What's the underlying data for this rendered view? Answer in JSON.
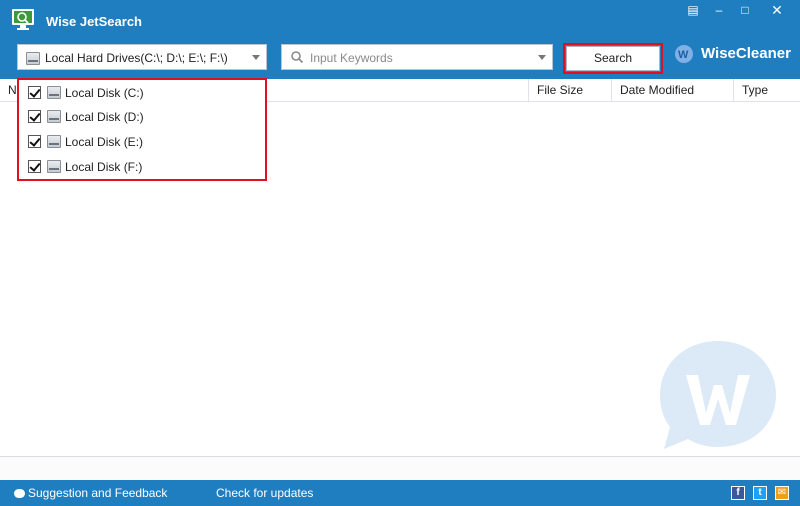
{
  "window": {
    "title": "Wise JetSearch",
    "controls": {
      "menu": "▤",
      "minimize": "–",
      "maximize": "□",
      "close": "✕"
    }
  },
  "toolbar": {
    "drive_select": {
      "value": "Local Hard Drives(C:\\; D:\\; E:\\; F:\\)"
    },
    "search": {
      "placeholder": "Input Keywords",
      "value": ""
    },
    "search_button": "Search",
    "brand": "WiseCleaner",
    "brand_logo_letter": "W"
  },
  "drive_list": {
    "items": [
      {
        "label": "Local Disk (C:)",
        "checked": true
      },
      {
        "label": "Local Disk (D:)",
        "checked": true
      },
      {
        "label": "Local Disk (E:)",
        "checked": true
      },
      {
        "label": "Local Disk (F:)",
        "checked": true
      }
    ]
  },
  "columns": {
    "name": "N",
    "size": "File Size",
    "date": "Date Modified",
    "type": "Type"
  },
  "footer": {
    "feedback": "Suggestion and Feedback",
    "updates": "Check for updates",
    "social": {
      "facebook": "f",
      "twitter": "t",
      "mail": "✉"
    }
  },
  "colors": {
    "header_blue": "#1f7ec0",
    "highlight_red": "#e1101e",
    "watermark": "#dce9f6"
  },
  "icons": {
    "app_logo": "monitor-magnifier-icon",
    "drive": "hard-drive-icon",
    "search": "magnifier-icon",
    "watermark": "wisecleaner-w-icon"
  }
}
